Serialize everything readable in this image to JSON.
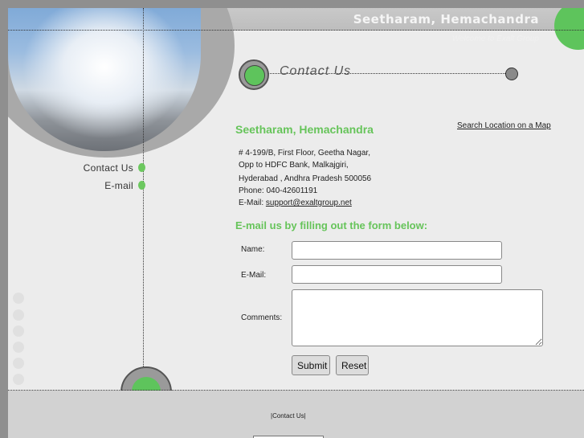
{
  "header": {
    "site_title": "Seetharam, Hemachandra",
    "tagline": "Welcome to Exalt Group"
  },
  "sidebar": {
    "items": [
      {
        "label": "Contact Us"
      },
      {
        "label": "E-mail"
      }
    ]
  },
  "page": {
    "title": "Contact Us"
  },
  "contact": {
    "company": "Seetharam, Hemachandra",
    "map_link": "Search Location on a Map",
    "address_lines": [
      "# 4-199/B, First Floor, Geetha Nagar,",
      "Opp to HDFC Bank, Malkajgiri,",
      "Hyderabad , Andhra Pradesh 500056",
      "Phone: 040-42601191"
    ],
    "email_label": "E-Mail:",
    "email": "support@exaltgroup.net"
  },
  "form": {
    "heading": "E-mail us by filling out the form below:",
    "name_label": "Name:",
    "name_value": "",
    "email_label": "E-Mail:",
    "email_value": "",
    "comments_label": "Comments:",
    "comments_value": "",
    "submit_label": "Submit",
    "reset_label": "Reset"
  },
  "footer": {
    "link": "|Contact Us|"
  },
  "colors": {
    "accent_green": "#5ec45c",
    "heading_green": "#66c45a",
    "background": "#ececec",
    "outer": "#8f8f8f"
  }
}
